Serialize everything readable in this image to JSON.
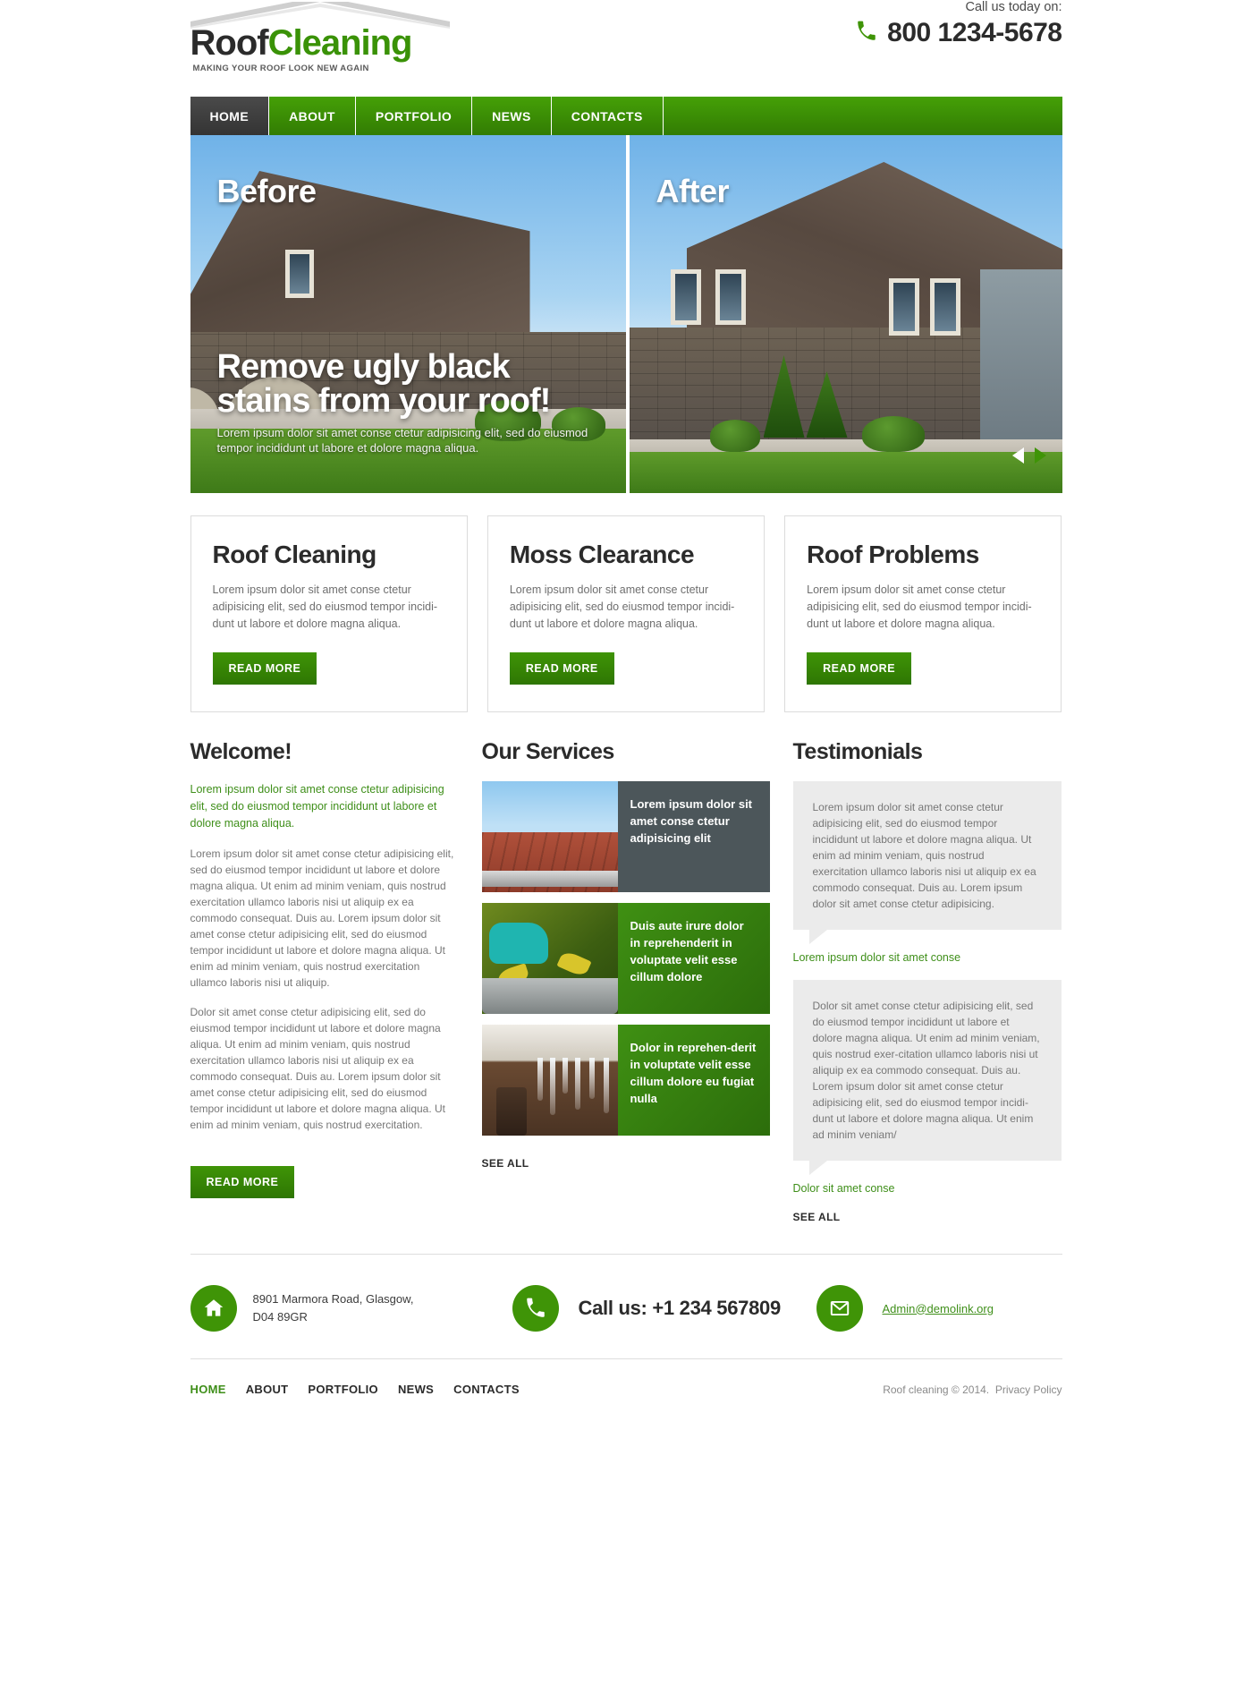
{
  "brand": {
    "logo_primary": "Roof",
    "logo_secondary": "Cleaning",
    "tagline": "MAKING YOUR ROOF LOOK NEW AGAIN",
    "green": "#3f9407",
    "dark": "#2b2b2b"
  },
  "header": {
    "call_label": "Call us today on:",
    "phone": "800 1234-5678"
  },
  "nav": {
    "items": [
      {
        "label": "HOME",
        "active": true
      },
      {
        "label": "ABOUT",
        "active": false
      },
      {
        "label": "PORTFOLIO",
        "active": false
      },
      {
        "label": "NEWS",
        "active": false
      },
      {
        "label": "CONTACTS",
        "active": false
      }
    ]
  },
  "slider": {
    "label_left": "Before",
    "label_right": "After",
    "headline_line1": "Remove ugly black",
    "headline_line2": "stains from your roof!",
    "subtext": "Lorem ipsum dolor sit amet conse ctetur adipisicing elit, sed do eiusmod tempor incididunt ut labore et dolore magna aliqua.",
    "prev_icon": "prev-arrow-icon",
    "next_icon": "next-arrow-icon"
  },
  "feature_boxes": [
    {
      "title": "Roof Cleaning",
      "text": "Lorem ipsum dolor sit amet conse ctetur adipisicing elit, sed do eiusmod tempor incidi-dunt ut labore et dolore magna aliqua.",
      "button": "READ MORE"
    },
    {
      "title": "Moss Clearance",
      "text": "Lorem ipsum dolor sit amet conse ctetur adipisicing elit, sed do eiusmod tempor incidi-dunt ut labore et dolore magna aliqua.",
      "button": "READ MORE"
    },
    {
      "title": "Roof Problems",
      "text": "Lorem ipsum dolor sit amet conse ctetur adipisicing elit, sed do eiusmod tempor incidi-dunt ut labore et dolore magna aliqua.",
      "button": "READ MORE"
    }
  ],
  "welcome": {
    "title": "Welcome!",
    "lead": "Lorem ipsum dolor sit amet conse ctetur adipisicing elit, sed do eiusmod tempor incididunt ut labore et dolore magna aliqua.",
    "paragraph1": "Lorem ipsum dolor sit amet conse ctetur adipisicing elit, sed do eiusmod tempor incididunt ut labore et dolore magna aliqua. Ut enim ad minim veniam, quis nostrud exercitation ullamco laboris nisi ut aliquip ex ea commodo consequat. Duis au. Lorem ipsum dolor sit amet conse ctetur adipisicing elit, sed do eiusmod tempor incididunt ut labore et dolore magna aliqua. Ut enim ad minim veniam, quis nostrud exercitation ullamco laboris nisi ut aliquip.",
    "paragraph2": "Dolor sit amet conse ctetur adipisicing elit, sed do eiusmod tempor incididunt ut labore et dolore magna aliqua. Ut enim ad minim veniam, quis nostrud exercitation ullamco laboris nisi ut aliquip ex ea commodo consequat. Duis au. Lorem ipsum dolor sit amet conse ctetur adipisicing elit, sed do eiusmod tempor incididunt ut labore et dolore magna aliqua. Ut enim ad minim veniam, quis nostrud exercitation.",
    "button": "READ MORE"
  },
  "services": {
    "title": "Our Services",
    "items": [
      {
        "text": "Lorem ipsum dolor sit amet conse ctetur adipisicing elit",
        "style": "dark",
        "image": "roof-shingles-gutter-photo"
      },
      {
        "text": "Duis aute irure dolor in reprehenderit in voluptate velit esse cillum dolore",
        "style": "green",
        "image": "gloved-hand-clearing-leaves-photo"
      },
      {
        "text": "Dolor in reprehen-derit in voluptate velit esse cillum dolore eu fugiat nulla",
        "style": "green",
        "image": "icicles-on-downspout-photo"
      }
    ],
    "see_all": "SEE ALL"
  },
  "testimonials": {
    "title": "Testimonials",
    "items": [
      {
        "quote": "Lorem ipsum dolor sit amet conse ctetur adipisicing elit, sed do eiusmod tempor incididunt ut labore et dolore magna aliqua. Ut enim ad minim veniam, quis nostrud exercitation ullamco laboris nisi ut aliquip ex ea commodo consequat. Duis au. Lorem ipsum dolor sit amet conse ctetur adipisicing.",
        "author": "Lorem ipsum dolor sit amet conse"
      },
      {
        "quote": "Dolor sit amet conse ctetur adipisicing elit, sed do eiusmod tempor incididunt ut labore et dolore magna aliqua. Ut enim ad minim veniam, quis nostrud exer-citation ullamco laboris nisi ut aliquip ex ea commodo consequat. Duis au. Lorem ipsum dolor sit amet conse ctetur adipisicing elit, sed do eiusmod tempor incidi-dunt ut labore et dolore magna aliqua. Ut enim ad minim veniam/",
        "author": "Dolor sit amet conse"
      }
    ],
    "see_all": "SEE ALL"
  },
  "contact": {
    "address": "8901 Marmora Road,  Glasgow,\nD04 89GR",
    "address_line1": "8901 Marmora Road,  Glasgow,",
    "address_line2": "D04 89GR",
    "phone_text": "Call us: +1 234 567809",
    "email": "Admin@demolink.org",
    "home_icon": "home-icon",
    "phone_icon": "phone-icon",
    "mail_icon": "envelope-icon"
  },
  "footer": {
    "links": [
      {
        "label": "HOME",
        "active": true
      },
      {
        "label": "ABOUT",
        "active": false
      },
      {
        "label": "PORTFOLIO",
        "active": false
      },
      {
        "label": "NEWS",
        "active": false
      },
      {
        "label": "CONTACTS",
        "active": false
      }
    ],
    "copyright": "Roof cleaning © 2014.",
    "privacy": "Privacy Policy"
  }
}
